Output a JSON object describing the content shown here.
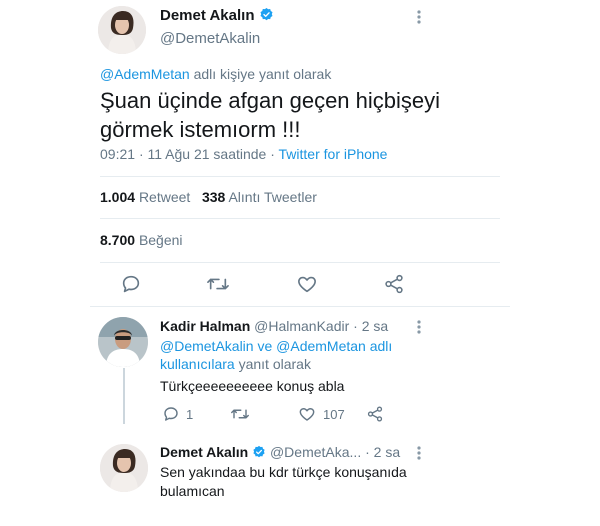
{
  "tweet": {
    "display_name": "Demet Akalın",
    "handle": "@DemetAkalin",
    "reply_to_user": "@AdemMetan",
    "reply_to_suffix": "adlı kişiye yanıt olarak",
    "text_line1": "Şuan üçinde afgan geçen hiçbişeyi",
    "text_line2": "görmek istemıorm !!!",
    "time": "09:21",
    "date": "· 11 Ağu 21 saatinde ·",
    "source": "Twitter for iPhone",
    "retweets_count": "1.004",
    "retweets_label": "Retweet",
    "quotes_count": "338",
    "quotes_label": "Alıntı Tweetler",
    "likes_count": "8.700",
    "likes_label": "Beğeni"
  },
  "reply1": {
    "display_name": "Kadir Halman",
    "handle": "@HalmanKadir",
    "age": "· 2 sa",
    "reply_to_line1": "@DemetAkalin ve @AdemMetan adlı",
    "reply_to_line2_link": "kullanıcılara",
    "reply_to_line2_suffix": "yanıt olarak",
    "text": "Türkçeeeeeeeeee konuş abla",
    "reply_count": "1",
    "like_count": "107"
  },
  "reply2": {
    "display_name": "Demet Akalın",
    "handle": "@DemetAka...",
    "age": "· 2 sa",
    "text_line1": "Sen yakındaa bu kdr türkçe konuşanıda",
    "text_line2": "bulamıcan"
  },
  "colors": {
    "accent": "#1b95e0",
    "muted": "#657786",
    "divider": "#e6ecf0",
    "verified": "#1da1f2"
  },
  "icons": [
    "more-icon",
    "verified-icon",
    "reply-icon",
    "retweet-icon",
    "like-icon",
    "share-icon"
  ]
}
